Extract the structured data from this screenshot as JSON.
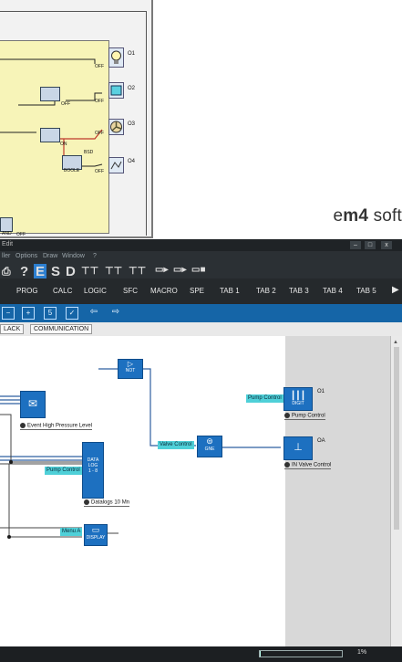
{
  "old_editor": {
    "outputs": [
      "O1",
      "O2",
      "O3",
      "O4"
    ],
    "off_labels": [
      "OFF",
      "OFF",
      "OFF",
      "OFF",
      "OFF",
      "OFF"
    ],
    "on_label": "ON",
    "bsd_label": "BSD",
    "bool_label": "BOOLE",
    "and_label": "AND"
  },
  "brand": {
    "prefix": "e",
    "bold": "m4",
    "suffix": " soft"
  },
  "window": {
    "title": "Edit"
  },
  "menu": {
    "items": [
      "ller",
      "Options",
      "Draw",
      "Window",
      "?"
    ]
  },
  "toolbar": {
    "letters": [
      "?",
      "E",
      "S",
      "D"
    ]
  },
  "tabs": [
    "PROG",
    "CALC",
    "LOGIC",
    "SFC",
    "MACRO",
    "SPE",
    "TAB 1",
    "TAB 2",
    "TAB 3",
    "TAB 4",
    "TAB 5"
  ],
  "subtabs": [
    "LACK",
    "COMMUNICATION"
  ],
  "diagram": {
    "event_caption": "Event  High Pressure Level",
    "datalog_caption": "Datalogs 10 Mn",
    "datalog_block": [
      "DATA",
      "LOG",
      "1 - 8"
    ],
    "pump_label_left": "Pump Control",
    "pump_label_right": "Pump Control",
    "valve_label": "Valve Control",
    "menu_label": "Menu A",
    "o1": "O1",
    "oa": "OA",
    "pump_caption": "Pump Control",
    "valve_caption": "IN Valve Control",
    "dig_label": "DIGIT",
    "disp_label": "DISPLAY",
    "not_label": "NOT",
    "gne_label": "GNE"
  },
  "status": {
    "percent": "1%"
  }
}
